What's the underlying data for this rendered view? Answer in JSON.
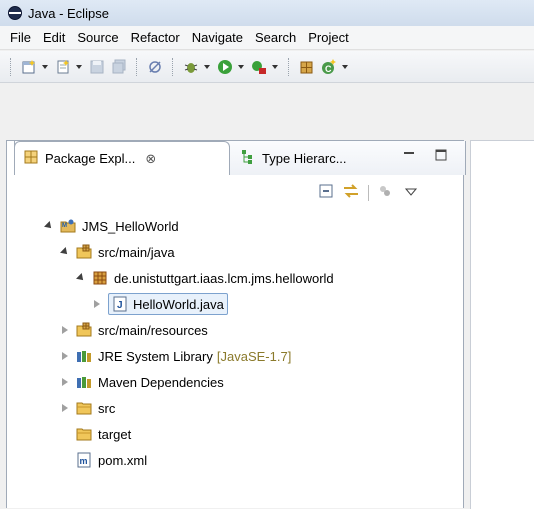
{
  "window": {
    "title": "Java - Eclipse"
  },
  "menu": [
    "File",
    "Edit",
    "Source",
    "Refactor",
    "Navigate",
    "Search",
    "Project"
  ],
  "tabs": {
    "package_explorer": "Package Expl...",
    "type_hierarchy": "Type Hierarc...",
    "close_glyph": "⊗"
  },
  "tree": {
    "project": "JMS_HelloWorld",
    "src_main_java": "src/main/java",
    "package": "de.unistuttgart.iaas.lcm.jms.helloworld",
    "file": "HelloWorld.java",
    "src_main_resources": "src/main/resources",
    "jre": "JRE System Library",
    "jre_version": "[JavaSE-1.7]",
    "maven": "Maven Dependencies",
    "src": "src",
    "target": "target",
    "pom": "pom.xml"
  },
  "colors": {
    "accent": "#7da2ce",
    "jre_version": "#8b7a2b"
  }
}
